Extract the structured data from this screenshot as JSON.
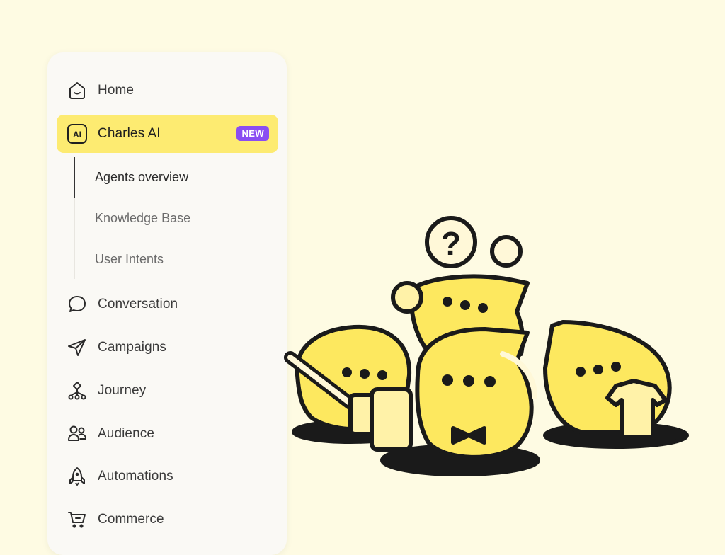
{
  "sidebar": {
    "items": [
      {
        "label": "Home",
        "icon": "home-icon"
      },
      {
        "label": "Charles AI",
        "icon": "ai-icon",
        "badge": "NEW",
        "icon_text": "AI",
        "active": true
      },
      {
        "label": "Conversation",
        "icon": "chat-bubble-icon"
      },
      {
        "label": "Campaigns",
        "icon": "paper-plane-icon"
      },
      {
        "label": "Journey",
        "icon": "journey-icon"
      },
      {
        "label": "Audience",
        "icon": "audience-icon"
      },
      {
        "label": "Automations",
        "icon": "rocket-icon"
      },
      {
        "label": "Commerce",
        "icon": "cart-icon"
      }
    ],
    "subitems": [
      {
        "label": "Agents overview",
        "current": true
      },
      {
        "label": "Knowledge Base"
      },
      {
        "label": "User Intents"
      }
    ]
  },
  "colors": {
    "background": "#FEFBE3",
    "active_highlight": "#FDEB71",
    "badge": "#8A4DF2",
    "mascot_yellow": "#FDE85F"
  }
}
